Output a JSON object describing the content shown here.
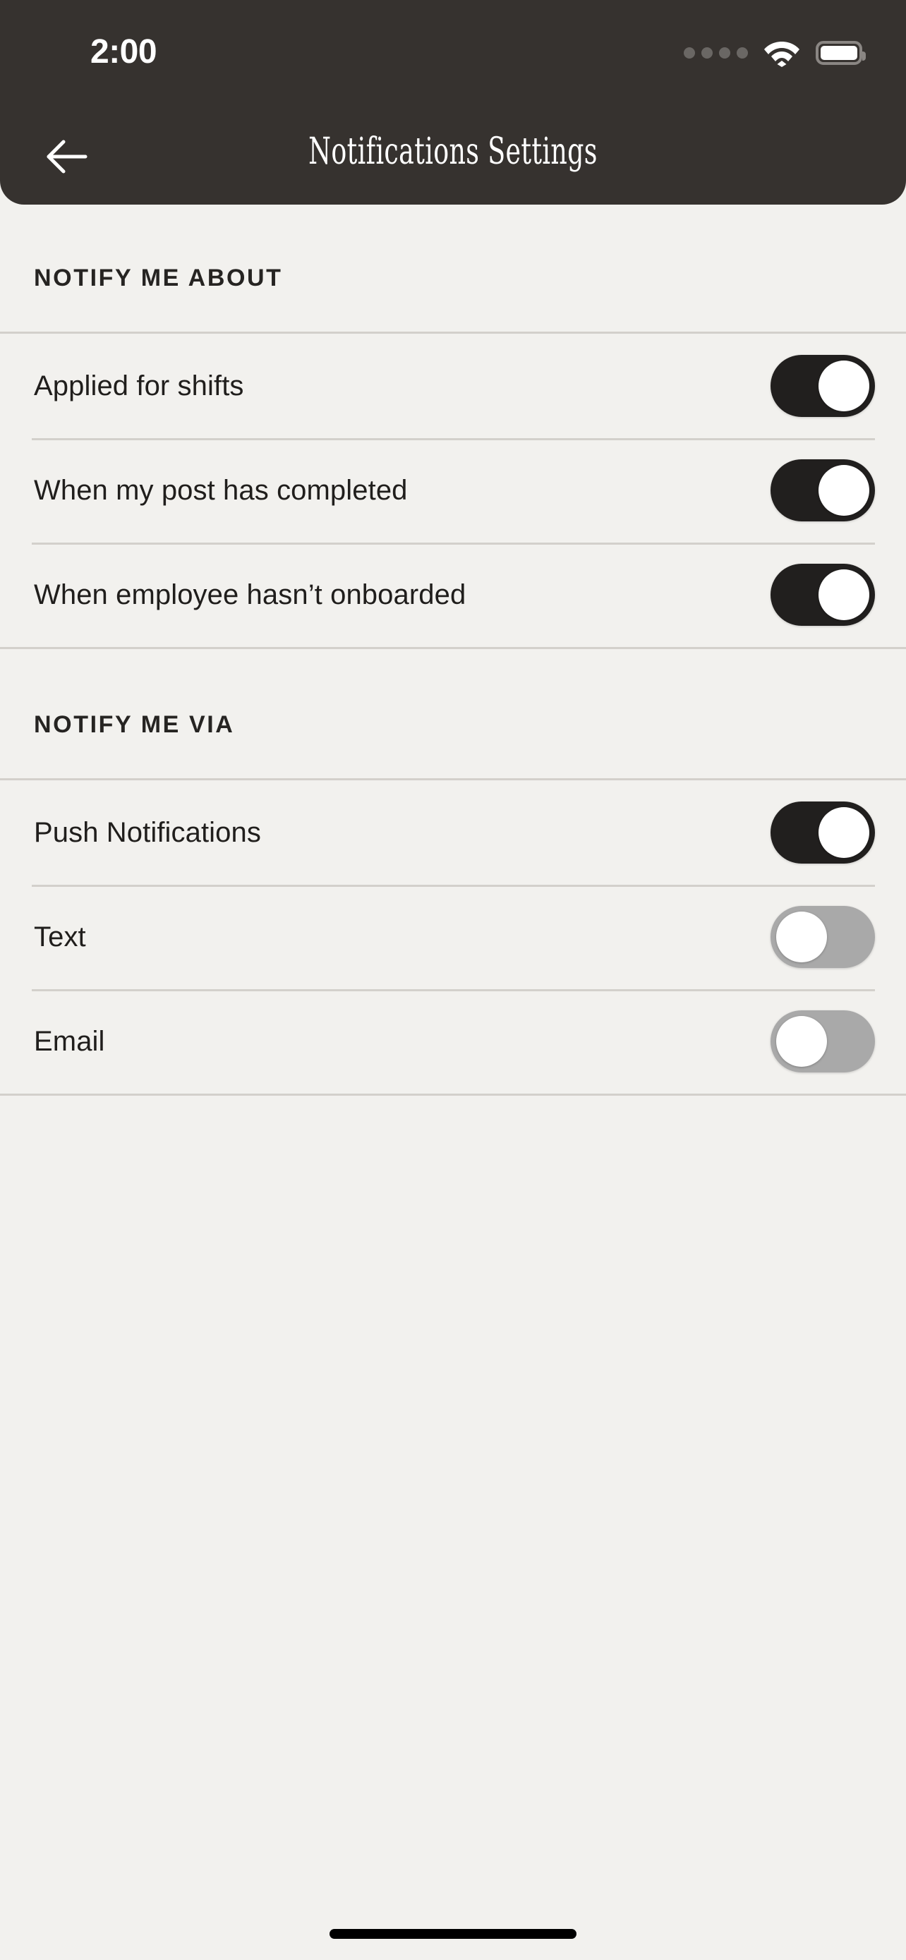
{
  "status_bar": {
    "time": "2:00",
    "signal_icon": "signal-dots-icon",
    "wifi_icon": "wifi-icon",
    "battery_icon": "battery-icon"
  },
  "nav": {
    "back_icon": "arrow-left-icon",
    "title": "Notifications Settings"
  },
  "theme": {
    "header_bg": "#36322F",
    "page_bg": "#F2F1EE",
    "divider": "#D3D0CB",
    "toggle_on": "#211F1E",
    "toggle_off": "#A9A9A9",
    "knob": "#FFFFFF",
    "text": "#201E1C"
  },
  "sections": [
    {
      "header": "NOTIFY ME ABOUT",
      "rows": [
        {
          "label": "Applied for shifts",
          "toggle": "on"
        },
        {
          "label": "When my post has completed",
          "toggle": "on"
        },
        {
          "label": "When employee hasn’t onboarded",
          "toggle": "on"
        }
      ]
    },
    {
      "header": "NOTIFY ME VIA",
      "rows": [
        {
          "label": "Push Notifications",
          "toggle": "on"
        },
        {
          "label": "Text",
          "toggle": "off"
        },
        {
          "label": "Email",
          "toggle": "off"
        }
      ]
    }
  ],
  "home_indicator": "home-indicator"
}
